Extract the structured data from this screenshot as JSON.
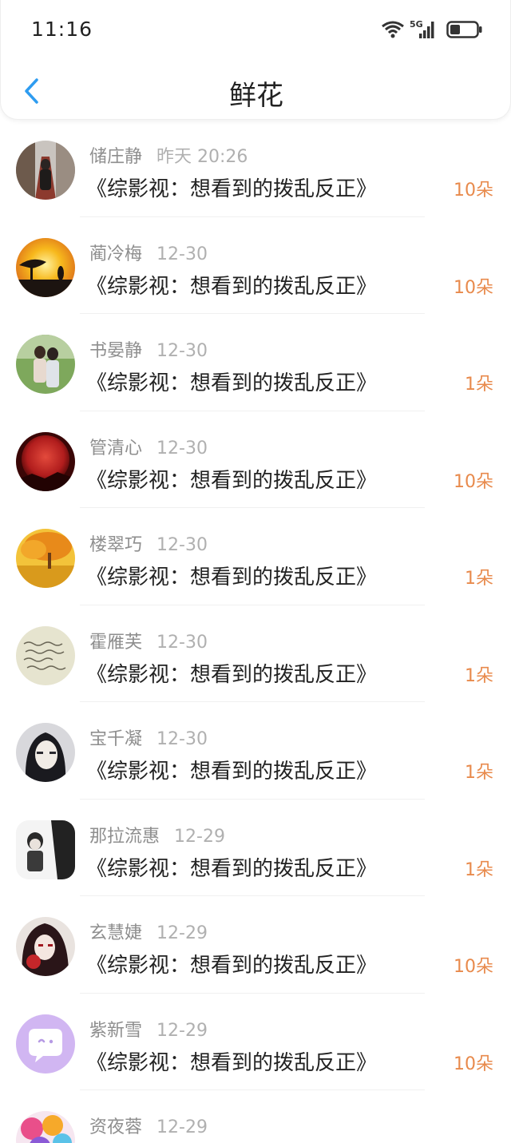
{
  "status_bar": {
    "time": "11:16",
    "network": "5G"
  },
  "nav": {
    "title": "鲜花"
  },
  "colors": {
    "accent": "#e88a4c",
    "back_blue": "#2e9cf0"
  },
  "items": [
    {
      "name": "储庄静",
      "date": "昨天 20:26",
      "book": "《综影视：想看到的拨乱反正》",
      "count": "10朵"
    },
    {
      "name": "蔺冷梅",
      "date": "12-30",
      "book": "《综影视：想看到的拨乱反正》",
      "count": "10朵"
    },
    {
      "name": "书晏静",
      "date": "12-30",
      "book": "《综影视：想看到的拨乱反正》",
      "count": "1朵"
    },
    {
      "name": "管清心",
      "date": "12-30",
      "book": "《综影视：想看到的拨乱反正》",
      "count": "10朵"
    },
    {
      "name": "楼翠巧",
      "date": "12-30",
      "book": "《综影视：想看到的拨乱反正》",
      "count": "1朵"
    },
    {
      "name": "霍雁芙",
      "date": "12-30",
      "book": "《综影视：想看到的拨乱反正》",
      "count": "1朵"
    },
    {
      "name": "宝千凝",
      "date": "12-30",
      "book": "《综影视：想看到的拨乱反正》",
      "count": "1朵"
    },
    {
      "name": "那拉流惠",
      "date": "12-29",
      "book": "《综影视：想看到的拨乱反正》",
      "count": "1朵"
    },
    {
      "name": "玄慧婕",
      "date": "12-29",
      "book": "《综影视：想看到的拨乱反正》",
      "count": "10朵"
    },
    {
      "name": "紫新雪",
      "date": "12-29",
      "book": "《综影视：想看到的拨乱反正》",
      "count": "10朵"
    },
    {
      "name": "资夜蓉",
      "date": "12-29",
      "book": "",
      "count": ""
    }
  ]
}
